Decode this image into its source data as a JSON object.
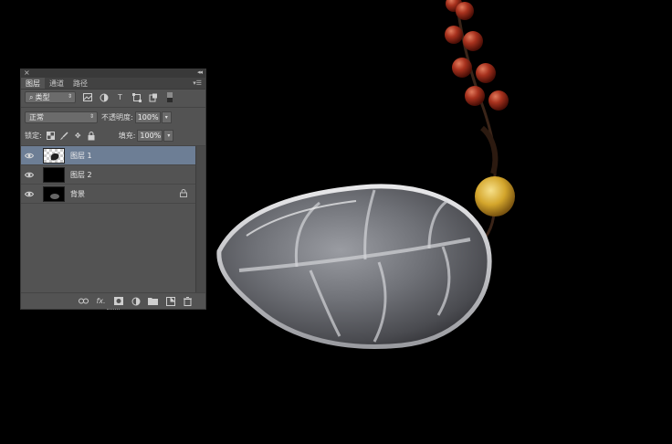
{
  "panel": {
    "tabs": [
      {
        "label": "图层",
        "active": true
      },
      {
        "label": "通道",
        "active": false
      },
      {
        "label": "路径",
        "active": false
      }
    ],
    "filter": {
      "label": "类型"
    },
    "blend_mode": "正常",
    "opacity_label": "不透明度:",
    "opacity_value": "100%",
    "lock_label": "锁定:",
    "fill_label": "填充:",
    "fill_value": "100%",
    "layers": [
      {
        "name": "图层 1",
        "selected": true,
        "visible": true
      },
      {
        "name": "图层 2",
        "selected": false,
        "visible": true
      },
      {
        "name": "背景",
        "selected": false,
        "visible": true,
        "locked": true
      }
    ]
  },
  "colors": {
    "panel_bg": "#535353",
    "selected_layer": "#6d7e95",
    "canvas_bg": "#000000",
    "bead_red": "#9e2d1d",
    "bead_yellow": "#d9b23a"
  }
}
